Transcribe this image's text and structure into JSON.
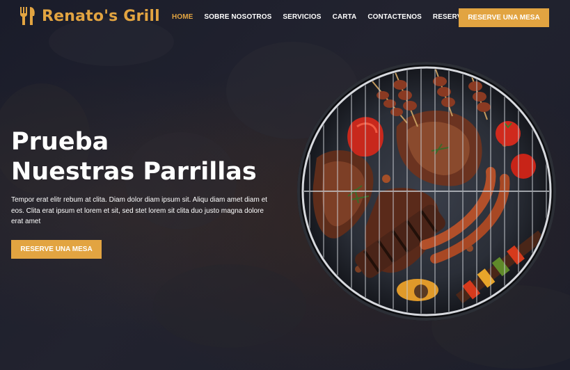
{
  "brand": {
    "name": "Renato's Grill",
    "icon": "utensils-icon",
    "color": "#e2a441"
  },
  "nav": {
    "items": [
      {
        "label": "HOME",
        "active": true
      },
      {
        "label": "SOBRE NOSOTROS",
        "active": false
      },
      {
        "label": "SERVICIOS",
        "active": false
      },
      {
        "label": "CARTA",
        "active": false
      },
      {
        "label": "CONTACTENOS",
        "active": false
      },
      {
        "label": "RESERVACIONES",
        "active": false
      }
    ],
    "cta_label": "RESERVE UNA MESA"
  },
  "hero": {
    "title_line1": "Prueba",
    "title_line2": "Nuestras Parrillas",
    "text": "Tempor erat elitr rebum at clita. Diam dolor diam ipsum sit. Aliqu diam amet diam et eos. Clita erat ipsum et lorem et sit, sed stet lorem sit clita duo justo magna dolore erat amet",
    "cta_label": "RESERVE UNA MESA",
    "image": "grilled-meats-barbecue-image"
  },
  "colors": {
    "accent": "#e2a441",
    "background": "#1f2130",
    "text": "#ffffff"
  }
}
